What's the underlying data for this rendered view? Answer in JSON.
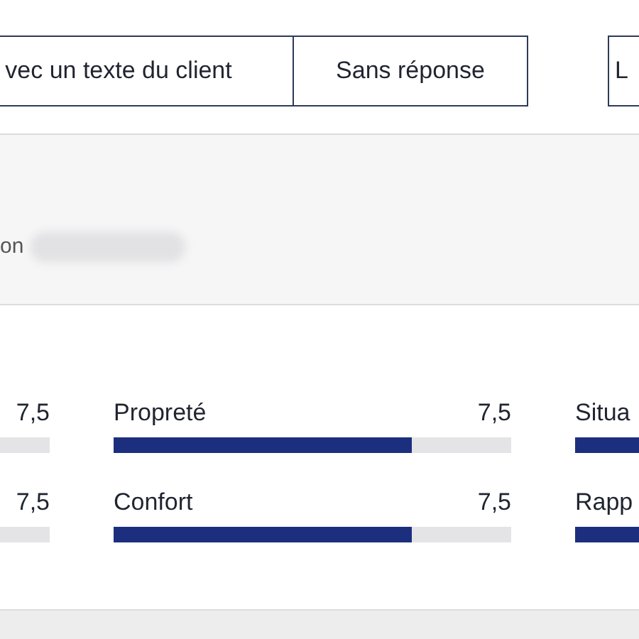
{
  "filters": [
    {
      "label": "vec un texte du client"
    },
    {
      "label": "Sans réponse"
    },
    {
      "label": "L"
    }
  ],
  "reviewer": {
    "text": "on"
  },
  "rating_columns": [
    {
      "items": [
        {
          "score": "7,5"
        },
        {
          "score": "7,5"
        }
      ]
    },
    {
      "items": [
        {
          "label": "Propreté",
          "score": "7,5",
          "level": 0.75
        },
        {
          "label": "Confort",
          "score": "7,5",
          "level": 0.75
        }
      ]
    },
    {
      "items": [
        {
          "label": "Situa"
        },
        {
          "label": "Rapp"
        }
      ]
    }
  ]
}
